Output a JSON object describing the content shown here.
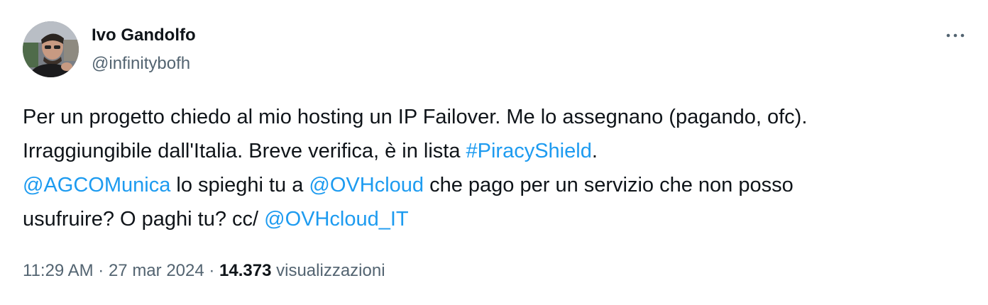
{
  "author": {
    "display_name": "Ivo Gandolfo",
    "handle": "@infinitybofh"
  },
  "more_icon": "more-dots-icon",
  "text": {
    "line1": "Per un progetto chiedo al mio hosting un IP Failover. Me lo assegnano (pagando, ofc).",
    "line2_prefix": "Irraggiungibile dall'Italia. Breve verifica, è in lista ",
    "hashtag": "#PiracyShield",
    "line2_suffix": ".",
    "mention1": "@AGCOMunica",
    "line3_mid1": " lo spieghi tu a ",
    "mention2": "@OVHcloud",
    "line3_suffix": " che pago per un servizio che non posso",
    "line4_prefix": "usufruire? O paghi tu? cc/ ",
    "mention3": "@OVHcloud_IT"
  },
  "meta": {
    "time": "11:29 AM",
    "sep1": " · ",
    "date": "27 mar 2024",
    "sep2": " · ",
    "views_count": "14.373",
    "views_label": " visualizzazioni"
  },
  "colors": {
    "link": "#1d9bf0",
    "secondary": "#536471",
    "primary": "#0f1419"
  }
}
